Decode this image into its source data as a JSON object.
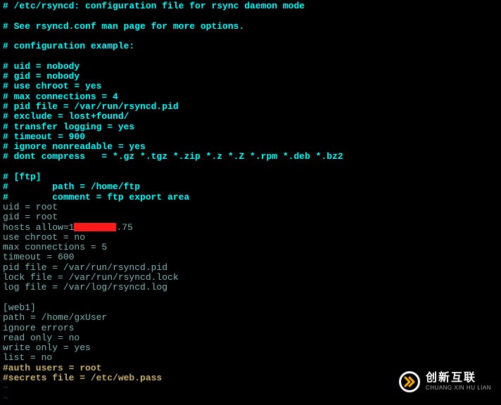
{
  "lines": [
    {
      "cls": "comment",
      "text": "# /etc/rsyncd: configuration file for rsync daemon mode"
    },
    {
      "cls": "comment",
      "text": ""
    },
    {
      "cls": "comment",
      "text": "# See rsyncd.conf man page for more options."
    },
    {
      "cls": "comment",
      "text": ""
    },
    {
      "cls": "comment",
      "text": "# configuration example:"
    },
    {
      "cls": "comment",
      "text": ""
    },
    {
      "cls": "comment",
      "text": "# uid = nobody"
    },
    {
      "cls": "comment",
      "text": "# gid = nobody"
    },
    {
      "cls": "comment",
      "text": "# use chroot = yes"
    },
    {
      "cls": "comment",
      "text": "# max connections = 4"
    },
    {
      "cls": "comment",
      "text": "# pid file = /var/run/rsyncd.pid"
    },
    {
      "cls": "comment",
      "text": "# exclude = lost+found/"
    },
    {
      "cls": "comment",
      "text": "# transfer logging = yes"
    },
    {
      "cls": "comment",
      "text": "# timeout = 900"
    },
    {
      "cls": "comment",
      "text": "# ignore nonreadable = yes"
    },
    {
      "cls": "comment",
      "text": "# dont compress   = *.gz *.tgz *.zip *.z *.Z *.rpm *.deb *.bz2"
    },
    {
      "cls": "comment",
      "text": ""
    },
    {
      "cls": "comment",
      "text": "# [ftp]"
    },
    {
      "cls": "comment",
      "text": "#        path = /home/ftp"
    },
    {
      "cls": "comment",
      "text": "#        comment = ftp export area"
    },
    {
      "cls": "active",
      "text": "uid = root"
    },
    {
      "cls": "active",
      "text": "gid = root"
    },
    {
      "cls": "active",
      "prefix": "hosts allow=1",
      "redact": true,
      "suffix": ".75"
    },
    {
      "cls": "active",
      "text": "use chroot = no"
    },
    {
      "cls": "active",
      "text": "max connections = 5"
    },
    {
      "cls": "active",
      "text": "timeout = 600"
    },
    {
      "cls": "active",
      "text": "pid file = /var/run/rsyncd.pid"
    },
    {
      "cls": "active",
      "text": "lock file = /var/run/rsyncd.lock"
    },
    {
      "cls": "active",
      "text": "log file = /var/log/rsyncd.log"
    },
    {
      "cls": "active",
      "text": ""
    },
    {
      "cls": "active",
      "text": "[web1]"
    },
    {
      "cls": "active",
      "text": "path = /home/gxUser"
    },
    {
      "cls": "active",
      "text": "ignore errors"
    },
    {
      "cls": "active",
      "text": "read only = no"
    },
    {
      "cls": "active",
      "text": "write only = yes"
    },
    {
      "cls": "active",
      "text": "list = no"
    },
    {
      "cls": "yellow",
      "text": "#auth users = root"
    },
    {
      "cls": "yellow",
      "text": "#secrets file = /etc/web.pass"
    },
    {
      "cls": "vi-tilde",
      "text": "~"
    },
    {
      "cls": "vi-tilde",
      "text": "~"
    }
  ],
  "watermark": {
    "cn": "创新互联",
    "en": "CHUANG XIN HU LIAN"
  }
}
